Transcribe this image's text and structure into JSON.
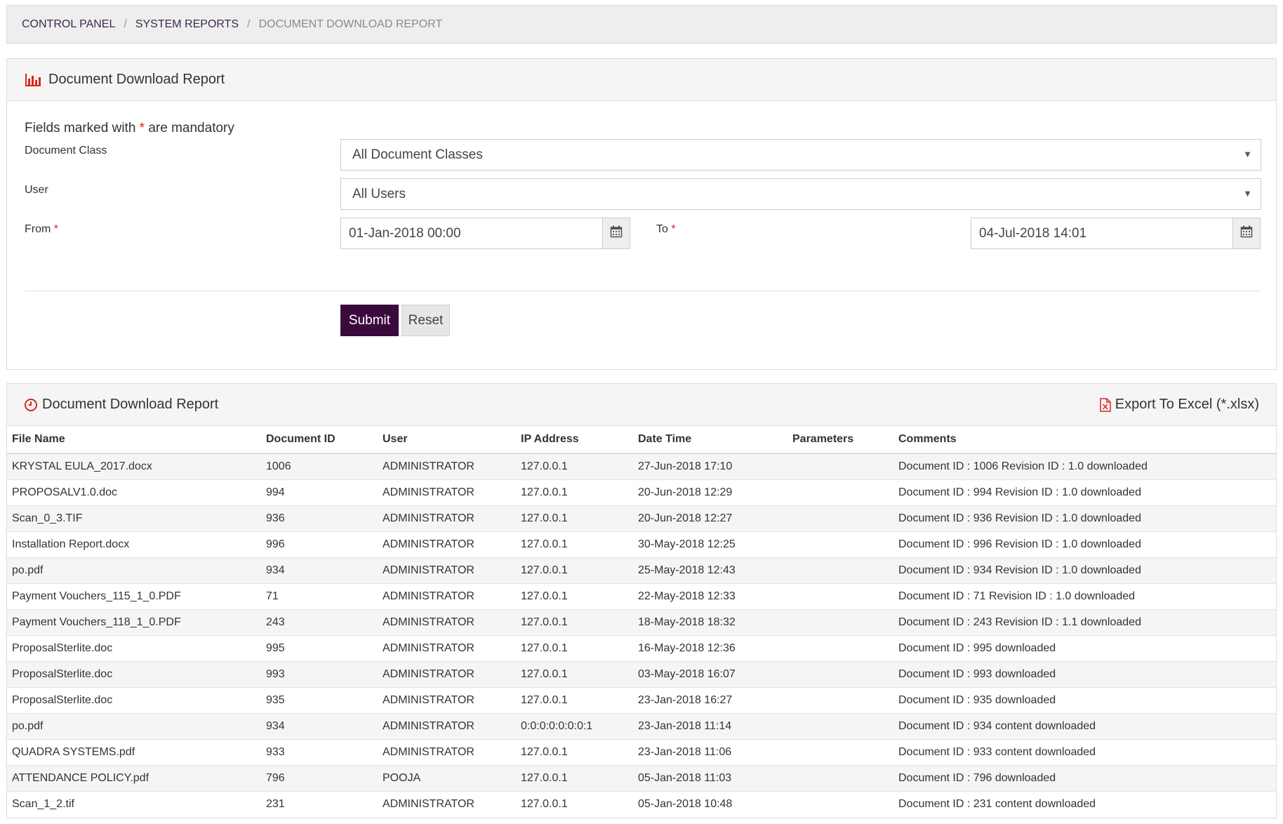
{
  "breadcrumb": [
    "CONTROL PANEL",
    "SYSTEM REPORTS",
    "DOCUMENT DOWNLOAD REPORT"
  ],
  "breadcrumb_separator": "/",
  "form": {
    "title": "Document Download Report",
    "mandatory_prefix": "Fields marked with",
    "mandatory_star": "*",
    "mandatory_suffix": "are mandatory",
    "document_class_label": "Document Class",
    "document_class_value": "All Document Classes",
    "user_label": "User",
    "user_value": "All Users",
    "from_label": "From",
    "from_value": "01-Jan-2018 00:00",
    "to_label": "To",
    "to_value": "04-Jul-2018 14:01",
    "submit_label": "Submit",
    "reset_label": "Reset"
  },
  "report": {
    "title": "Document Download Report",
    "export_label": "Export To Excel (*.xlsx)",
    "columns": [
      "File Name",
      "Document ID",
      "User",
      "IP Address",
      "Date Time",
      "Parameters",
      "Comments"
    ],
    "rows": [
      [
        "KRYSTAL EULA_2017.docx",
        "1006",
        "ADMINISTRATOR",
        "127.0.0.1",
        "27-Jun-2018 17:10",
        "",
        "Document ID : 1006 Revision ID : 1.0 downloaded"
      ],
      [
        "PROPOSALV1.0.doc",
        "994",
        "ADMINISTRATOR",
        "127.0.0.1",
        "20-Jun-2018 12:29",
        "",
        "Document ID : 994 Revision ID : 1.0 downloaded"
      ],
      [
        "Scan_0_3.TIF",
        "936",
        "ADMINISTRATOR",
        "127.0.0.1",
        "20-Jun-2018 12:27",
        "",
        "Document ID : 936 Revision ID : 1.0 downloaded"
      ],
      [
        "Installation Report.docx",
        "996",
        "ADMINISTRATOR",
        "127.0.0.1",
        "30-May-2018 12:25",
        "",
        "Document ID : 996 Revision ID : 1.0 downloaded"
      ],
      [
        "po.pdf",
        "934",
        "ADMINISTRATOR",
        "127.0.0.1",
        "25-May-2018 12:43",
        "",
        "Document ID : 934 Revision ID : 1.0 downloaded"
      ],
      [
        "Payment Vouchers_115_1_0.PDF",
        "71",
        "ADMINISTRATOR",
        "127.0.0.1",
        "22-May-2018 12:33",
        "",
        "Document ID : 71 Revision ID : 1.0 downloaded"
      ],
      [
        "Payment Vouchers_118_1_0.PDF",
        "243",
        "ADMINISTRATOR",
        "127.0.0.1",
        "18-May-2018 18:32",
        "",
        "Document ID : 243 Revision ID : 1.1 downloaded"
      ],
      [
        "ProposalSterlite.doc",
        "995",
        "ADMINISTRATOR",
        "127.0.0.1",
        "16-May-2018 12:36",
        "",
        "Document ID : 995 downloaded"
      ],
      [
        "ProposalSterlite.doc",
        "993",
        "ADMINISTRATOR",
        "127.0.0.1",
        "03-May-2018 16:07",
        "",
        "Document ID : 993 downloaded"
      ],
      [
        "ProposalSterlite.doc",
        "935",
        "ADMINISTRATOR",
        "127.0.0.1",
        "23-Jan-2018 16:27",
        "",
        "Document ID : 935 downloaded"
      ],
      [
        "po.pdf",
        "934",
        "ADMINISTRATOR",
        "0:0:0:0:0:0:0:1",
        "23-Jan-2018 11:14",
        "",
        "Document ID : 934 content downloaded"
      ],
      [
        "QUADRA SYSTEMS.pdf",
        "933",
        "ADMINISTRATOR",
        "127.0.0.1",
        "23-Jan-2018 11:06",
        "",
        "Document ID : 933 content downloaded"
      ],
      [
        "ATTENDANCE POLICY.pdf",
        "796",
        "POOJA",
        "127.0.0.1",
        "05-Jan-2018 11:03",
        "",
        "Document ID : 796 downloaded"
      ],
      [
        "Scan_1_2.tif",
        "231",
        "ADMINISTRATOR",
        "127.0.0.1",
        "05-Jan-2018 10:48",
        "",
        "Document ID : 231 content downloaded"
      ]
    ]
  },
  "icons": {
    "bar_chart": "bar-chart-icon",
    "clock": "clock-icon",
    "excel": "excel-file-icon",
    "calendar": "calendar-icon",
    "caret": "caret-down-icon"
  },
  "colors": {
    "accent_red": "#d9251c",
    "submit_bg": "#3b0a3d"
  }
}
